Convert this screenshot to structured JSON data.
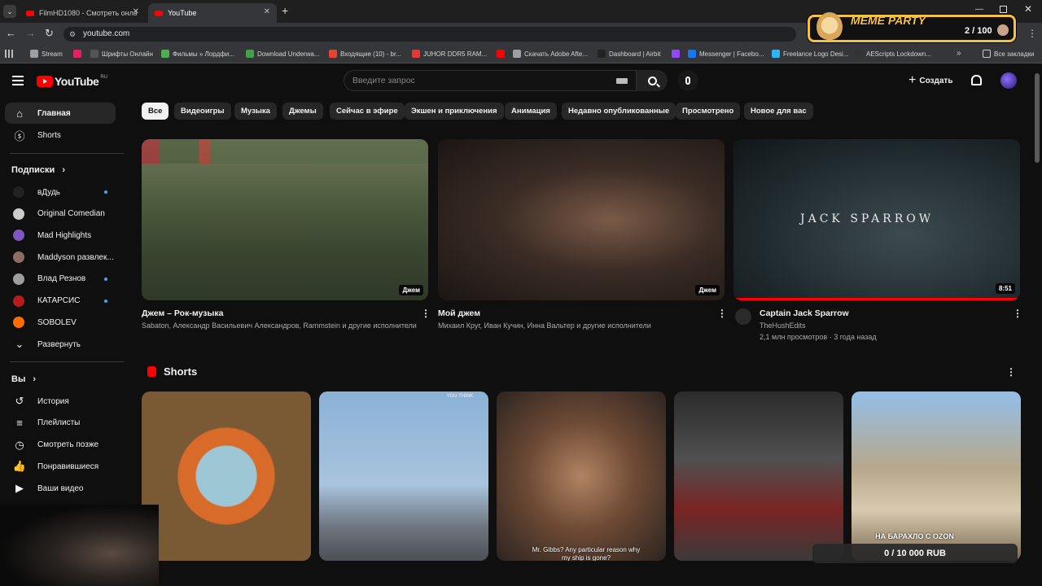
{
  "browser": {
    "tabs": [
      {
        "title": "FilmHD1080 - Смотреть онлайн"
      },
      {
        "title": "YouTube"
      }
    ],
    "url": "youtube.com",
    "bookmarks": [
      {
        "label": "Stream",
        "color": "#9aa0a6"
      },
      {
        "label": "",
        "color": "#e91e63"
      },
      {
        "label": "Шрифты Онлайн",
        "color": "#555555"
      },
      {
        "label": "Фильмы » Лордфи...",
        "color": "#4caf50"
      },
      {
        "label": "Download Underwa...",
        "color": "#43a047"
      },
      {
        "label": "Входящие (10) - br...",
        "color": "#ea4335"
      },
      {
        "label": "JUHOR DDR5 RAM...",
        "color": "#e53935"
      },
      {
        "label": "",
        "color": "#ff0000"
      },
      {
        "label": "Скачать Adobe Afte...",
        "color": "#9aa0a6"
      },
      {
        "label": "Dashboard | Airbit",
        "color": "#222222"
      },
      {
        "label": "",
        "color": "#9146ff"
      },
      {
        "label": "Messenger | Facebo...",
        "color": "#1877f2"
      },
      {
        "label": "Freelance Logo Desi...",
        "color": "#29b6f6"
      },
      {
        "label": "AEScripts Lockdown...",
        "color": "#333333"
      }
    ],
    "all_bookmarks": "Все закладки"
  },
  "widget": {
    "title": "MEME PARTY",
    "counter": "2 / 100",
    "donation": "0 / 10 000 RUB",
    "accent": "#f6c23b"
  },
  "youtube": {
    "logo": "YouTube",
    "region": "RU",
    "search_placeholder": "Введите запрос",
    "create_label": "Создать",
    "sidebar": {
      "main": [
        {
          "label": "Главная",
          "icon": "home-icon",
          "active": true
        },
        {
          "label": "Shorts",
          "icon": "shorts-icon",
          "active": false
        }
      ],
      "subs_header": "Подписки",
      "subs": [
        {
          "label": "вДудь",
          "color": "#222222",
          "dot": true
        },
        {
          "label": "Original Comedian",
          "color": "#cccccc",
          "dot": false
        },
        {
          "label": "Mad Highlights",
          "color": "#7e57c2",
          "dot": false
        },
        {
          "label": "Maddyson развлек...",
          "color": "#8d6e63",
          "dot": false
        },
        {
          "label": "Влад Резнов",
          "color": "#9e9e9e",
          "dot": true
        },
        {
          "label": "КАТАРСИС",
          "color": "#b71c1c",
          "dot": true
        },
        {
          "label": "SOBOLEV",
          "color": "#ff6d00",
          "dot": false
        }
      ],
      "expand": "Развернуть",
      "you_header": "Вы",
      "you": [
        {
          "label": "История",
          "icon": "history-icon"
        },
        {
          "label": "Плейлисты",
          "icon": "playlist-icon"
        },
        {
          "label": "Смотреть позже",
          "icon": "clock-icon"
        },
        {
          "label": "Понравившиеся",
          "icon": "like-icon"
        },
        {
          "label": "Ваши видео",
          "icon": "video-icon"
        }
      ]
    },
    "chips": [
      "Все",
      "Видеоигры",
      "Музыка",
      "Джемы",
      "Сейчас в эфире",
      "Экшен и приключения",
      "Анимация",
      "Недавно опубликованные",
      "Просмотрено",
      "Новое для вас"
    ],
    "videos": [
      {
        "title": "Джем – Рок-музыка",
        "meta1": "Sabaton, Александр Васильевич Александров, Rammstein и другие исполнители",
        "meta2": "",
        "badge": "Джем"
      },
      {
        "title": "Мой джем",
        "meta1": "Михаил Круг, Иван Кучин, Инна Вальтер и другие исполнители",
        "meta2": "",
        "badge": "Джем"
      },
      {
        "title": "Captain Jack Sparrow",
        "meta1": "TheHushEdits",
        "meta2": "2,1 млн просмотров · 3 года назад",
        "badge": "8:51",
        "overlay": "JACK SPARROW",
        "progress": 1.0
      }
    ],
    "shorts_header": "Shorts",
    "shorts": [
      {
        "caption": ""
      },
      {
        "caption": "YOU THINK"
      },
      {
        "caption": "Mr. Gibbs? Any particular reason why my ship is gone?"
      },
      {
        "caption": ""
      },
      {
        "caption": "НА БАРАХЛО С OZON"
      }
    ]
  }
}
